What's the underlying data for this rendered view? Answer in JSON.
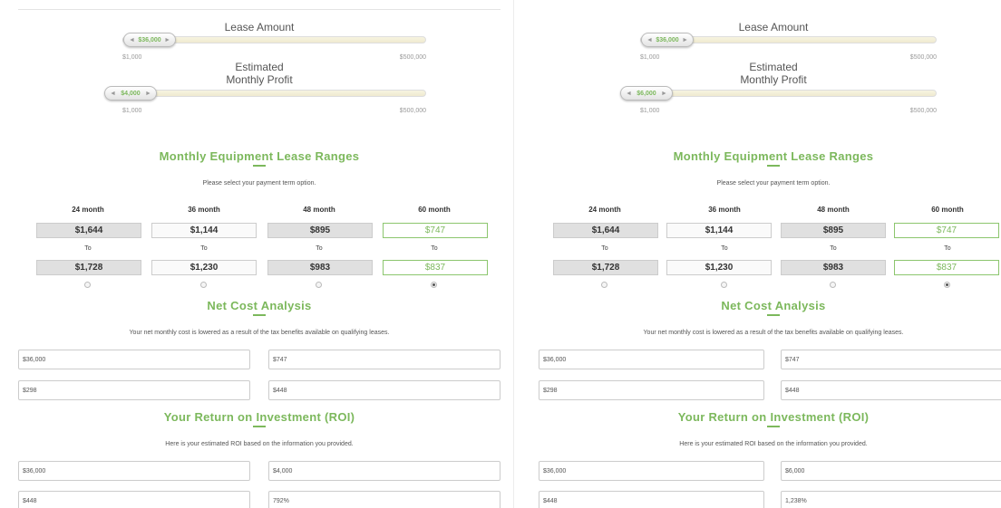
{
  "accent": "#7cb85c",
  "left": {
    "lease_amount": {
      "title": "Lease Amount",
      "value": "$36,000",
      "min": "$1,000",
      "max": "$500,000",
      "arrow_left": "◄",
      "arrow_right": "►"
    },
    "monthly_profit": {
      "title_line1": "Estimated",
      "title_line2": "Monthly Profit",
      "value": "$4,000",
      "min": "$1,000",
      "max": "$500,000",
      "arrow_left": "◄",
      "arrow_right": "►"
    },
    "ranges": {
      "title": "Monthly Equipment Lease Ranges",
      "subtitle": "Please select your payment term option.",
      "to_label": "To",
      "columns": [
        {
          "term": "24 month",
          "low": "$1,644",
          "high": "$1,728",
          "selected": false
        },
        {
          "term": "36 month",
          "low": "$1,144",
          "high": "$1,230",
          "selected": false
        },
        {
          "term": "48 month",
          "low": "$895",
          "high": "$983",
          "selected": false
        },
        {
          "term": "60 month",
          "low": "$747",
          "high": "$837",
          "selected": true
        }
      ]
    },
    "net_cost": {
      "title": "Net Cost Analysis",
      "subtitle": "Your net monthly cost is lowered as a result of the tax benefits available on qualifying leases.",
      "fields": [
        "$36,000",
        "$747",
        "$298",
        "$448"
      ]
    },
    "roi": {
      "title": "Your Return on Investment (ROI)",
      "subtitle": "Here is your estimated ROI based on the information you provided.",
      "fields": [
        "$36,000",
        "$4,000",
        "$448",
        "792%"
      ]
    }
  },
  "right": {
    "lease_amount": {
      "title": "Lease Amount",
      "value": "$36,000",
      "min": "$1,000",
      "max": "$500,000",
      "arrow_left": "◄",
      "arrow_right": "►"
    },
    "monthly_profit": {
      "title_line1": "Estimated",
      "title_line2": "Monthly Profit",
      "value": "$6,000",
      "min": "$1,000",
      "max": "$500,000",
      "arrow_left": "◄",
      "arrow_right": "►"
    },
    "ranges": {
      "title": "Monthly Equipment Lease Ranges",
      "subtitle": "Please select your payment term option.",
      "to_label": "To",
      "columns": [
        {
          "term": "24 month",
          "low": "$1,644",
          "high": "$1,728",
          "selected": false
        },
        {
          "term": "36 month",
          "low": "$1,144",
          "high": "$1,230",
          "selected": false
        },
        {
          "term": "48 month",
          "low": "$895",
          "high": "$983",
          "selected": false
        },
        {
          "term": "60 month",
          "low": "$747",
          "high": "$837",
          "selected": true
        }
      ]
    },
    "net_cost": {
      "title": "Net Cost Analysis",
      "subtitle": "Your net monthly cost is lowered as a result of the tax benefits available on qualifying leases.",
      "fields": [
        "$36,000",
        "$747",
        "$298",
        "$448"
      ]
    },
    "roi": {
      "title": "Your Return on Investment (ROI)",
      "subtitle": "Here is your estimated ROI based on the information you provided.",
      "fields": [
        "$36,000",
        "$6,000",
        "$448",
        "1,238%"
      ]
    }
  }
}
